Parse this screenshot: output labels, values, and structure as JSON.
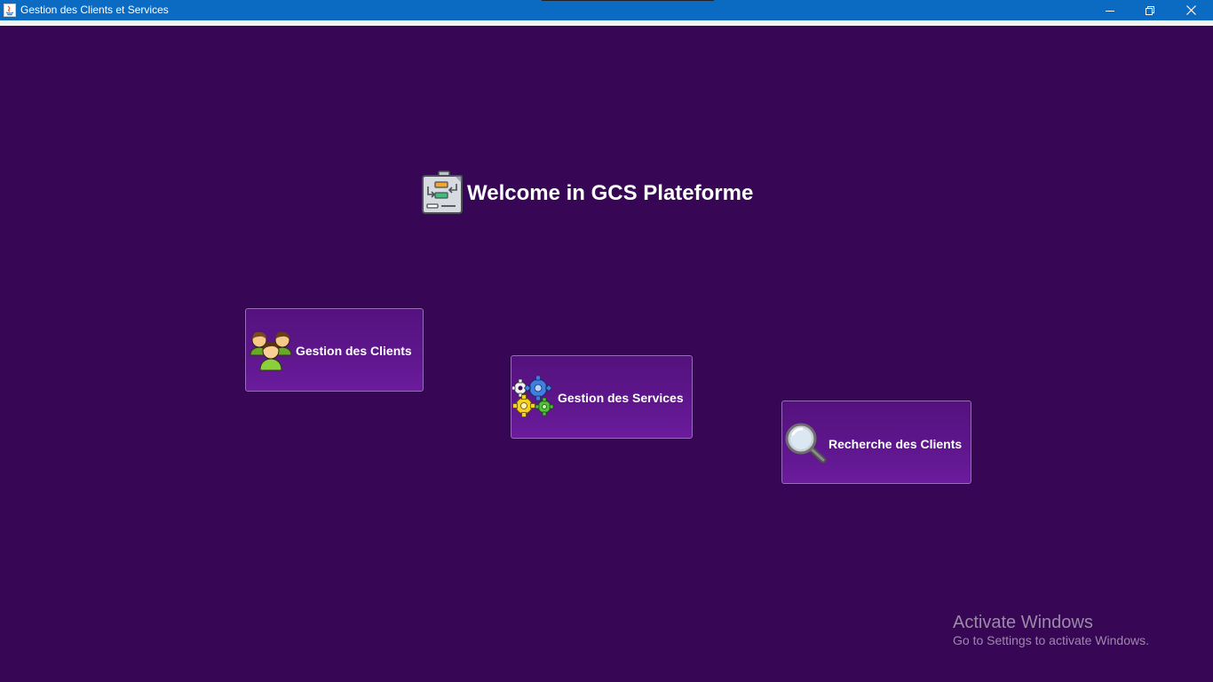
{
  "window": {
    "title": "Gestion des Clients et Services",
    "controls": [
      "minimize-icon",
      "restore-icon",
      "close-icon"
    ]
  },
  "main": {
    "welcome_title": "Welcome in GCS Plateforme",
    "tiles": [
      {
        "label": "Gestion des Clients",
        "icon": "users-icon"
      },
      {
        "label": "Gestion des Services",
        "icon": "gears-icon"
      },
      {
        "label": "Recherche des Clients",
        "icon": "magnifier-icon"
      }
    ]
  },
  "watermark": {
    "line1": "Activate Windows",
    "line2": "Go to Settings to activate Windows."
  },
  "colors": {
    "titlebar": "#0b6bc3",
    "background": "#370655",
    "tile": "#5e168c"
  }
}
